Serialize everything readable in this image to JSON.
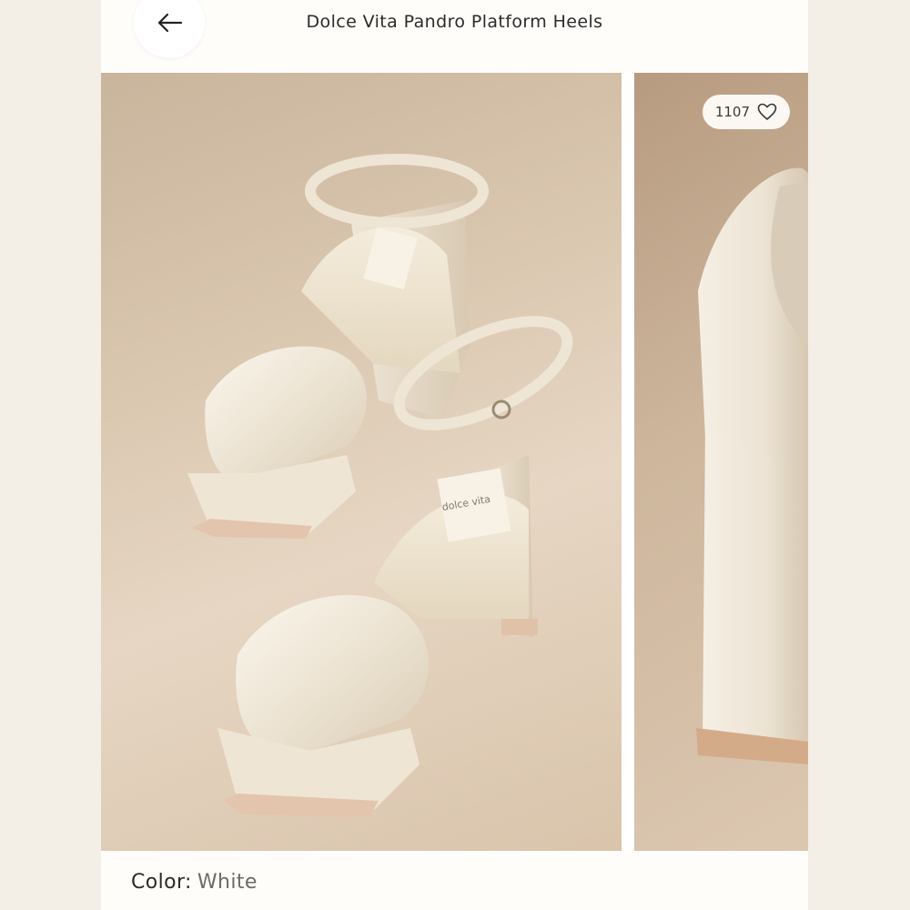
{
  "header": {
    "title": "Dolce Vita Pandro Platform Heels",
    "back_icon": "arrow-left-icon"
  },
  "gallery": {
    "likes_count": "1107",
    "heart_icon": "heart-outline-icon",
    "main_image_label": "dolce vita"
  },
  "product": {
    "color_label": "Color:",
    "color_value": "White"
  },
  "colors": {
    "background": "#f3efe7",
    "topbar": "#fffdf9",
    "text": "#2b2b2b",
    "photo_tan": "#dbc8b1",
    "shoe_cream": "#f3ede1"
  }
}
